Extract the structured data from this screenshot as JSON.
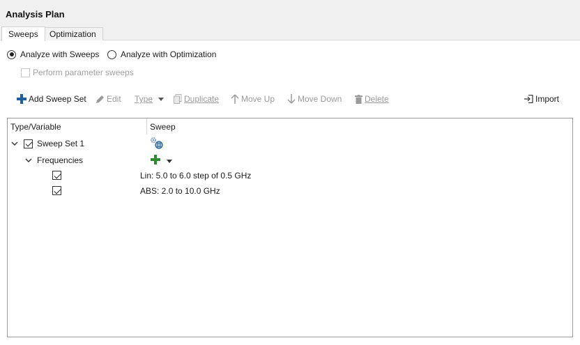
{
  "title": "Analysis Plan",
  "tabs": [
    {
      "label": "Sweeps",
      "active": true
    },
    {
      "label": "Optimization",
      "active": false
    }
  ],
  "mode": {
    "sweeps_label": "Analyze with Sweeps",
    "optimization_label": "Analyze with Optimization",
    "selected": "sweeps"
  },
  "param_sweeps": {
    "label": "Perform parameter sweeps",
    "checked": false,
    "enabled": false
  },
  "toolbar": {
    "add_sweep_set": "Add Sweep Set",
    "edit": "Edit",
    "type": "Type",
    "duplicate": "Duplicate",
    "move_up": "Move Up",
    "move_down": "Move Down",
    "delete": "Delete",
    "import": "Import"
  },
  "grid": {
    "columns": [
      "Type/Variable",
      "Sweep"
    ],
    "rows": [
      {
        "label": "Sweep Set 1",
        "checked": true,
        "icon": "gear-globe-icon"
      },
      {
        "label": "Frequencies",
        "icon": "add-icon"
      },
      {
        "sweep": "Lin: 5.0 to 6.0 step of 0.5 GHz",
        "checked": true
      },
      {
        "sweep": "ABS: 2.0 to 10.0 GHz",
        "checked": true
      }
    ]
  },
  "colors": {
    "accent_blue": "#1f5f9e",
    "add_green": "#2e8b2e",
    "disabled": "#9a9a9a"
  }
}
